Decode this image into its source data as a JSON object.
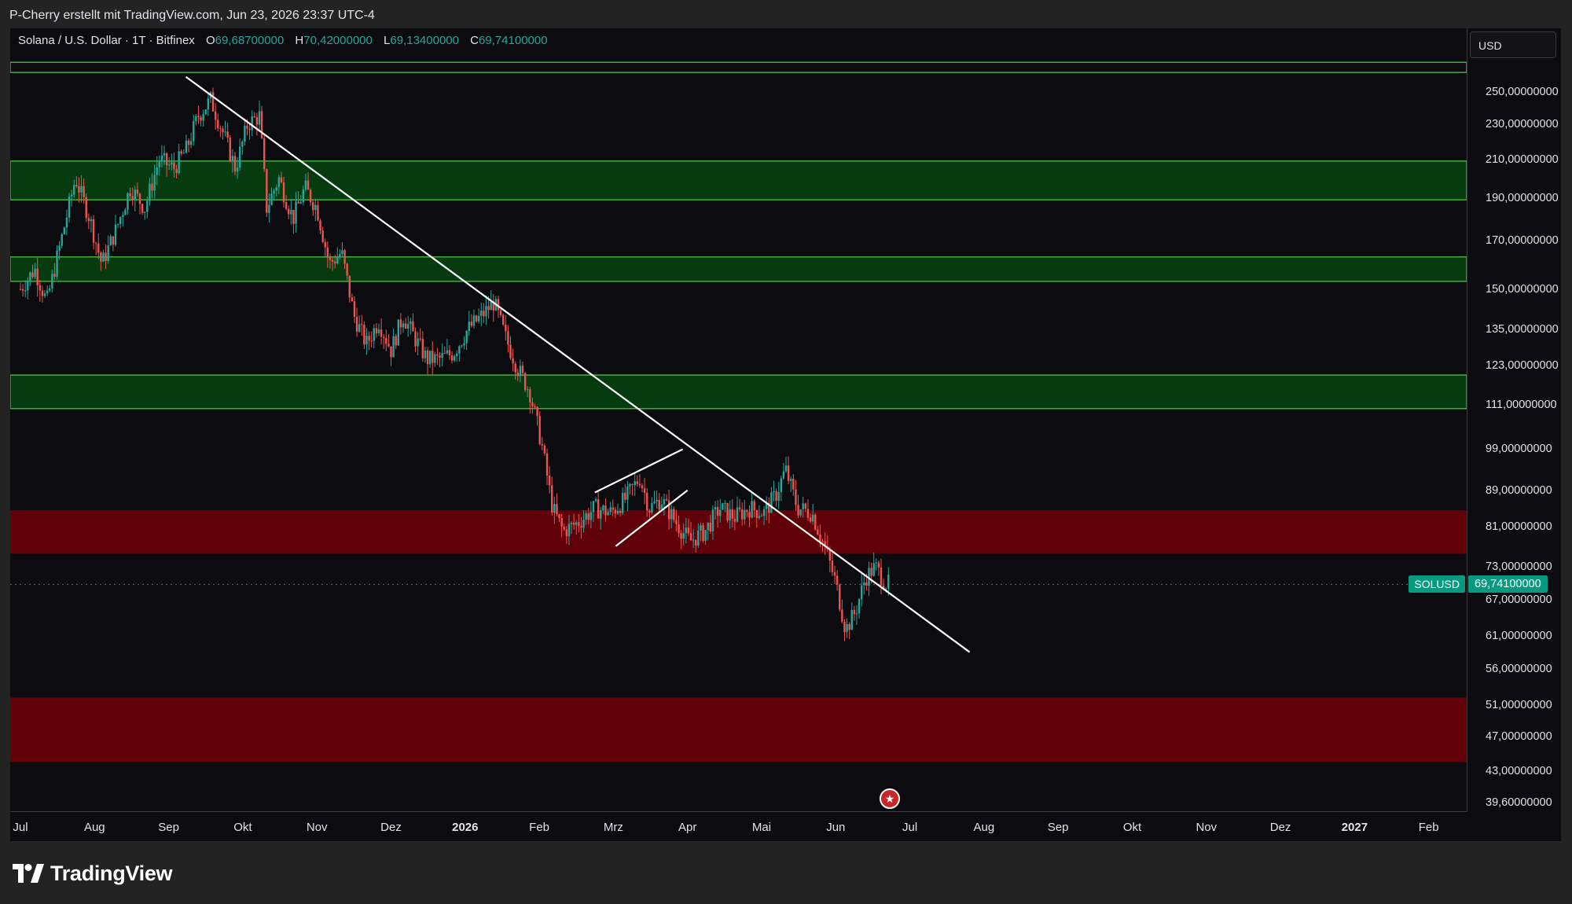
{
  "header": {
    "attribution": "P-Cherry erstellt mit TradingView.com, Jun 23, 2026 23:37 UTC-4"
  },
  "legend": {
    "symbol_text": "Solana / U.S. Dollar · 1T · Bitfinex",
    "open_label": "O",
    "open": "69,68700000",
    "high_label": "H",
    "high": "70,42000000",
    "low_label": "L",
    "low": "69,13400000",
    "close_label": "C",
    "close": "69,74100000"
  },
  "currency_button": "USD",
  "brand": "TradingView",
  "colors": {
    "up": "#26a69a",
    "down": "#ef5350",
    "support_zone": "#600008",
    "resistance_zone": "#063b10",
    "zone_border": "#3fae3f",
    "trendline": "#ffffff",
    "price_tag": "#089981"
  },
  "chart_data": {
    "type": "candlestick",
    "symbol": "SOLUSD",
    "exchange": "Bitfinex",
    "interval": "1T",
    "last_price": "69,74100000",
    "y_scale": "log",
    "ylim": [
      39.6,
      272
    ],
    "xlim": [
      "2025-07-01",
      "2027-02-28"
    ],
    "y_ticks": [
      "250,00000000",
      "230,00000000",
      "210,00000000",
      "190,00000000",
      "170,00000000",
      "150,00000000",
      "135,00000000",
      "123,00000000",
      "111,00000000",
      "99,00000000",
      "89,00000000",
      "81,00000000",
      "73,00000000",
      "67,00000000",
      "61,00000000",
      "56,00000000",
      "51,00000000",
      "47,00000000",
      "43,00000000",
      "39,60000000"
    ],
    "y_tick_values": [
      250,
      230,
      210,
      190,
      170,
      150,
      135,
      123,
      111,
      99,
      89,
      81,
      73,
      67,
      61,
      56,
      51,
      47,
      43,
      39.6
    ],
    "x_ticks": [
      {
        "label": "Jul",
        "date": "2025-07-01"
      },
      {
        "label": "Aug",
        "date": "2025-08-01"
      },
      {
        "label": "Sep",
        "date": "2025-09-01"
      },
      {
        "label": "Okt",
        "date": "2025-10-01"
      },
      {
        "label": "Nov",
        "date": "2025-11-01"
      },
      {
        "label": "Dez",
        "date": "2025-12-01"
      },
      {
        "label": "2026",
        "date": "2026-01-01",
        "year": true
      },
      {
        "label": "Feb",
        "date": "2026-02-01"
      },
      {
        "label": "Mrz",
        "date": "2026-03-01"
      },
      {
        "label": "Apr",
        "date": "2026-04-01"
      },
      {
        "label": "Mai",
        "date": "2026-05-01"
      },
      {
        "label": "Jun",
        "date": "2026-06-01"
      },
      {
        "label": "Jul",
        "date": "2026-07-01"
      },
      {
        "label": "Aug",
        "date": "2026-08-01"
      },
      {
        "label": "Sep",
        "date": "2026-09-01"
      },
      {
        "label": "Okt",
        "date": "2026-10-01"
      },
      {
        "label": "Nov",
        "date": "2026-11-01"
      },
      {
        "label": "Dez",
        "date": "2026-12-01"
      },
      {
        "label": "2027",
        "date": "2027-01-01",
        "year": true
      },
      {
        "label": "Feb",
        "date": "2027-02-01"
      }
    ],
    "price_path": [
      [
        "2025-07-01",
        150
      ],
      [
        "2025-07-07",
        158
      ],
      [
        "2025-07-12",
        145
      ],
      [
        "2025-07-18",
        170
      ],
      [
        "2025-07-24",
        200
      ],
      [
        "2025-07-30",
        180
      ],
      [
        "2025-08-04",
        160
      ],
      [
        "2025-08-10",
        175
      ],
      [
        "2025-08-16",
        195
      ],
      [
        "2025-08-22",
        185
      ],
      [
        "2025-08-28",
        210
      ],
      [
        "2025-09-03",
        205
      ],
      [
        "2025-09-08",
        215
      ],
      [
        "2025-09-13",
        235
      ],
      [
        "2025-09-18",
        245
      ],
      [
        "2025-09-23",
        225
      ],
      [
        "2025-09-28",
        205
      ],
      [
        "2025-10-03",
        230
      ],
      [
        "2025-10-08",
        235
      ],
      [
        "2025-10-11",
        185
      ],
      [
        "2025-10-16",
        200
      ],
      [
        "2025-10-22",
        180
      ],
      [
        "2025-10-27",
        195
      ],
      [
        "2025-11-01",
        185
      ],
      [
        "2025-11-06",
        160
      ],
      [
        "2025-11-11",
        165
      ],
      [
        "2025-11-16",
        140
      ],
      [
        "2025-11-21",
        130
      ],
      [
        "2025-11-26",
        138
      ],
      [
        "2025-12-01",
        128
      ],
      [
        "2025-12-06",
        140
      ],
      [
        "2025-12-11",
        132
      ],
      [
        "2025-12-16",
        125
      ],
      [
        "2025-12-21",
        125
      ],
      [
        "2025-12-27",
        127
      ],
      [
        "2026-01-02",
        135
      ],
      [
        "2026-01-08",
        140
      ],
      [
        "2026-01-13",
        145
      ],
      [
        "2026-01-18",
        132
      ],
      [
        "2026-01-23",
        122
      ],
      [
        "2026-01-28",
        115
      ],
      [
        "2026-02-02",
        100
      ],
      [
        "2026-02-06",
        85
      ],
      [
        "2026-02-10",
        80
      ],
      [
        "2026-02-16",
        82
      ],
      [
        "2026-02-22",
        85
      ],
      [
        "2026-02-28",
        84
      ],
      [
        "2026-03-06",
        87
      ],
      [
        "2026-03-12",
        92
      ],
      [
        "2026-03-16",
        85
      ],
      [
        "2026-03-21",
        87
      ],
      [
        "2026-03-27",
        82
      ],
      [
        "2026-04-02",
        78
      ],
      [
        "2026-04-08",
        80
      ],
      [
        "2026-04-14",
        85
      ],
      [
        "2026-04-20",
        83
      ],
      [
        "2026-04-26",
        85
      ],
      [
        "2026-05-02",
        84
      ],
      [
        "2026-05-07",
        88
      ],
      [
        "2026-05-11",
        94
      ],
      [
        "2026-05-16",
        85
      ],
      [
        "2026-05-22",
        84
      ],
      [
        "2026-05-28",
        76
      ],
      [
        "2026-06-01",
        70
      ],
      [
        "2026-06-05",
        62
      ],
      [
        "2026-06-09",
        65
      ],
      [
        "2026-06-13",
        71
      ],
      [
        "2026-06-17",
        73
      ],
      [
        "2026-06-21",
        70
      ],
      [
        "2026-06-23",
        69.74
      ]
    ],
    "zones": [
      {
        "kind": "resistance",
        "low": 263,
        "high": 270
      },
      {
        "kind": "resistance",
        "low": 189,
        "high": 209
      },
      {
        "kind": "resistance",
        "low": 153,
        "high": 163
      },
      {
        "kind": "resistance",
        "low": 110,
        "high": 120
      },
      {
        "kind": "support",
        "low": 75.5,
        "high": 84.5
      },
      {
        "kind": "support",
        "low": 44,
        "high": 52
      }
    ],
    "trendlines": [
      {
        "from": [
          "2025-09-08",
          260
        ],
        "to": [
          "2026-07-26",
          58.5
        ]
      },
      {
        "from": [
          "2026-02-22",
          88.5
        ],
        "to": [
          "2026-03-30",
          99
        ]
      },
      {
        "from": [
          "2026-03-02",
          77
        ],
        "to": [
          "2026-04-01",
          89
        ]
      }
    ]
  }
}
